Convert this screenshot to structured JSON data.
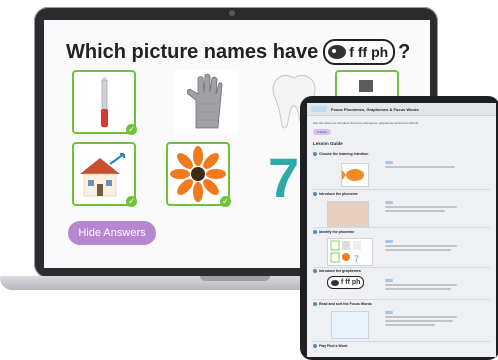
{
  "laptop": {
    "question": {
      "text": "Which picture names have",
      "phoneme_label": "f ff ph",
      "mark": "?"
    },
    "tiles": [
      {
        "name": "knife",
        "selected": true
      },
      {
        "name": "glove",
        "selected": false
      },
      {
        "name": "tooth",
        "selected": false
      },
      {
        "name": "extra",
        "selected": true
      },
      {
        "name": "house",
        "selected": true
      },
      {
        "name": "flower",
        "selected": true
      },
      {
        "name": "seven",
        "selected": false
      }
    ],
    "seven_text": "7",
    "hide_button_label": "Hide Answers",
    "check_glyph": "✓",
    "colors": {
      "selected_border": "#6fc23a",
      "button": "#b686cf",
      "numeral": "#2fa8a8"
    }
  },
  "tablet": {
    "title": "Focus Phonemes, Graphemes & Focus Words",
    "subtitle": "Use the lesson to introduce the focus phonemes, graphemes and Focus Words.",
    "badge": "Teacher",
    "lesson_guide": "Lesson Guide",
    "sections": [
      "Choose the learning intention",
      "Introduce the phoneme",
      "Identify the phoneme",
      "Introduce the graphemes",
      "Read and sort the Focus Words",
      "Play Find a Word"
    ],
    "chip_label": "f ff ph"
  }
}
